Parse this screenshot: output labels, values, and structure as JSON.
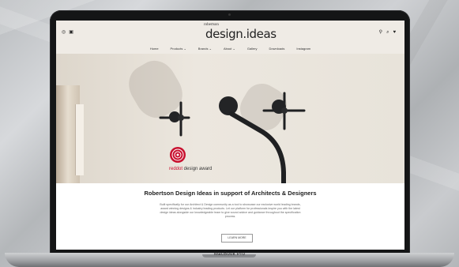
{
  "device": {
    "model_label": "MacBook Pro"
  },
  "site": {
    "logo_small": "robertson",
    "logo": "design.ideas",
    "nav": [
      "Home",
      "Products ⌄",
      "Brands ⌄",
      "About ⌄",
      "Gallery",
      "Downloads",
      "Instagram"
    ],
    "header_icons_left": [
      "instagram-icon",
      "youtube-icon"
    ],
    "header_icons_right": [
      "user-icon",
      "search-icon",
      "heart-icon"
    ],
    "hero": {
      "award_red": "red",
      "award_dot": "dot",
      "award_rest": " design award"
    },
    "content": {
      "title": "Robertson Design Ideas in support of Architects & Designers",
      "description": "Built specifically for our Architect & Design community as a tool to showcase our exclusive world leading brands, award winning designs & industry leading products. Let our platform for professionals inspire you with the latest design ideas alongside our knowledgeable team to give sound advice and guidance throughout the specification process.",
      "button": "LEARN MORE"
    }
  },
  "colors": {
    "accent": "#c8102e",
    "header_bg": "#efebe5",
    "tap_finish": "#1f2022"
  }
}
